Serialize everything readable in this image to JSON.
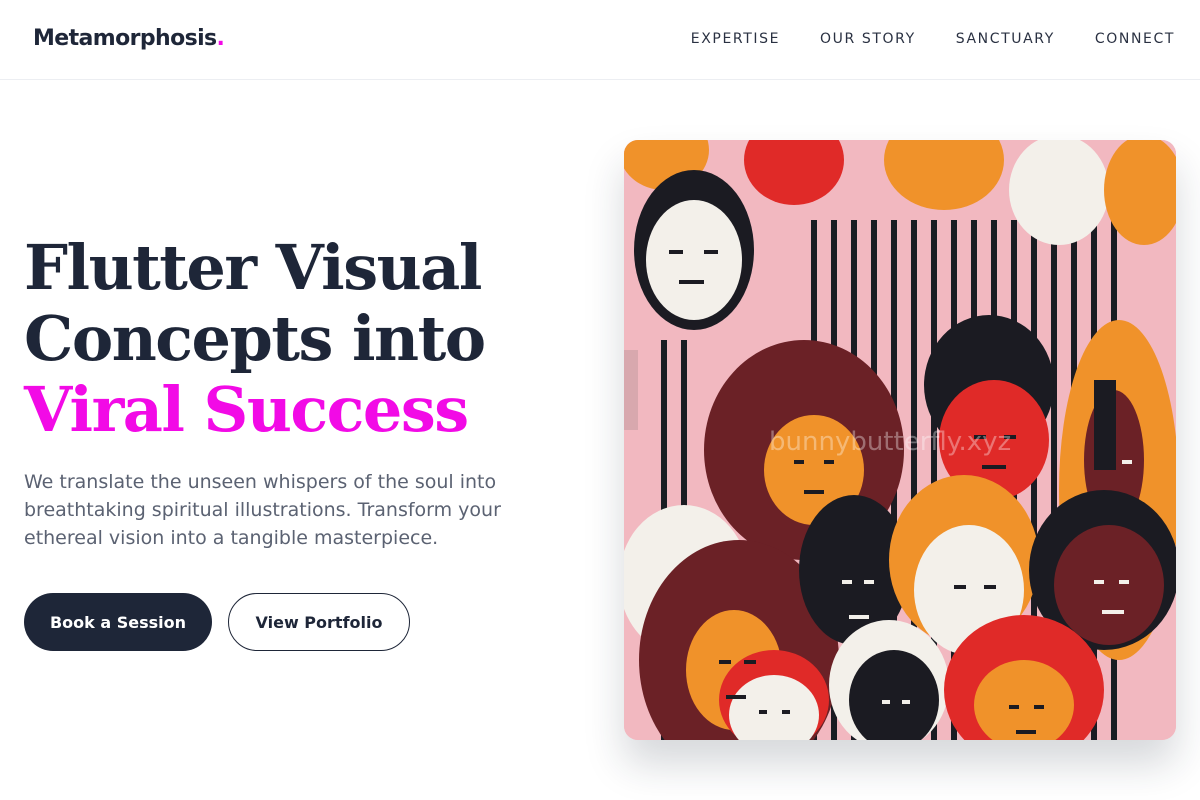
{
  "header": {
    "logo_text": "Metamorphosis",
    "logo_dot": ".",
    "nav": [
      {
        "label": "EXPERTISE"
      },
      {
        "label": "OUR STORY"
      },
      {
        "label": "SANCTUARY"
      },
      {
        "label": "CONNECT"
      }
    ]
  },
  "hero": {
    "title_line1": "Flutter Visual",
    "title_line2": "Concepts into",
    "title_accent": "Viral Success",
    "description": "We translate the unseen whispers of the soul into breathtaking spiritual illustrations. Transform your ethereal vision into a tangible masterpiece.",
    "primary_button": "Book a Session",
    "secondary_button": "View Portfolio"
  },
  "artwork": {
    "watermark": "bunnybutterfly.xyz"
  },
  "colors": {
    "accent": "#f20ae6",
    "navy": "#1e2638",
    "muted_text": "#5b6272"
  }
}
